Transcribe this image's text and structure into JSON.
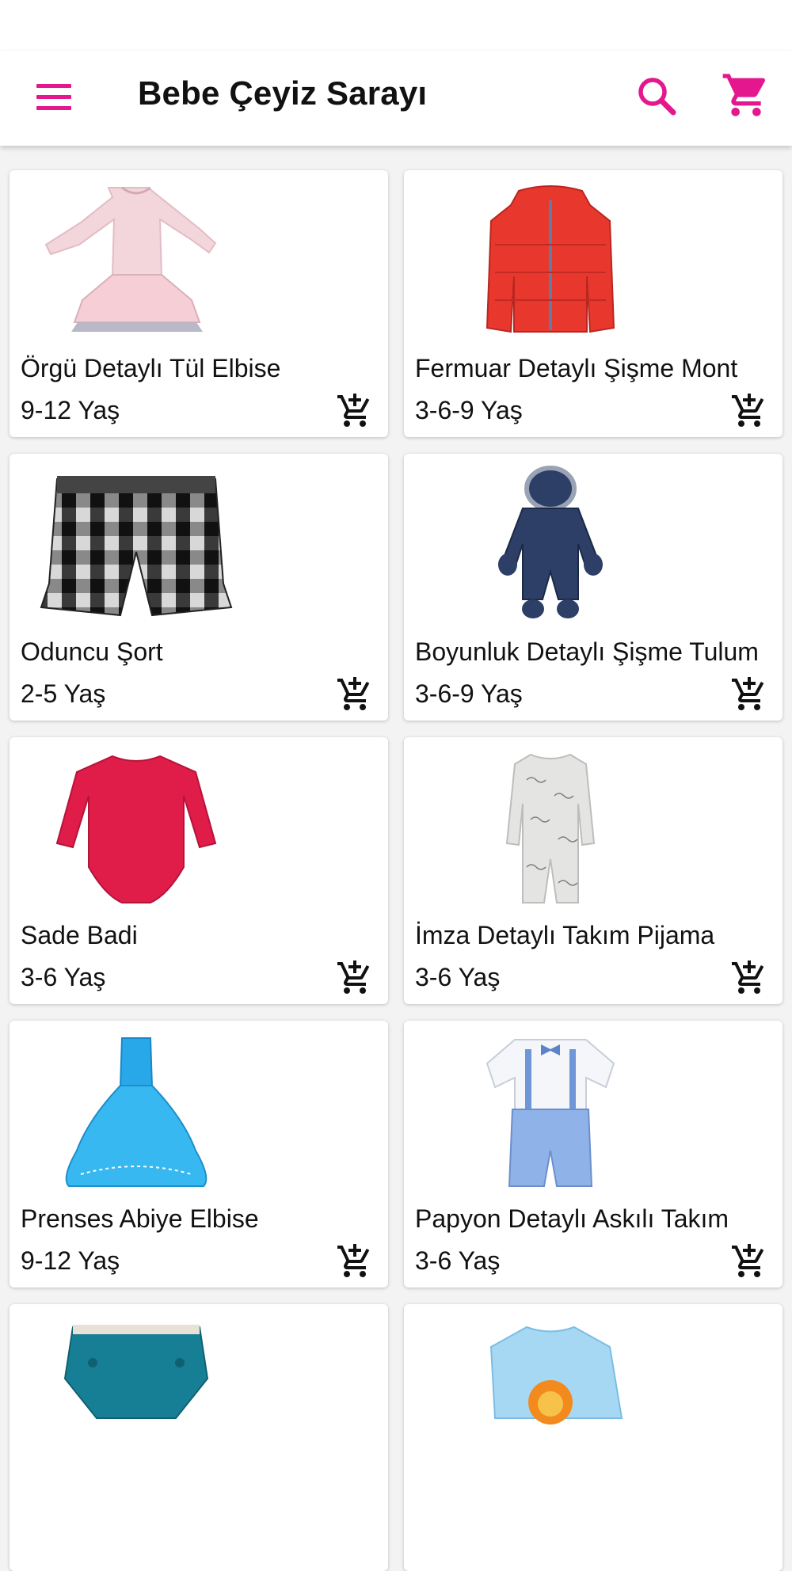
{
  "app_bar": {
    "title": "Bebe Çeyiz Sarayı",
    "accent_color": "#e5178f",
    "icons": [
      "menu-icon",
      "search-icon",
      "cart-icon"
    ]
  },
  "products": [
    {
      "name": "Örgü Detaylı Tül Elbise",
      "age": "9-12 Yaş"
    },
    {
      "name": "Fermuar Detaylı Şişme Mont",
      "age": "3-6-9 Yaş"
    },
    {
      "name": "Oduncu Şort",
      "age": "2-5 Yaş"
    },
    {
      "name": "Boyunluk Detaylı Şişme Tulum",
      "age": "3-6-9 Yaş"
    },
    {
      "name": "Sade Badi",
      "age": "3-6 Yaş"
    },
    {
      "name": "İmza Detaylı Takım Pijama",
      "age": "3-6 Yaş"
    },
    {
      "name": "Prenses Abiye Elbise",
      "age": "9-12 Yaş"
    },
    {
      "name": "Papyon Detaylı Askılı Takım",
      "age": "3-6 Yaş"
    },
    {
      "name": "",
      "age": ""
    },
    {
      "name": "",
      "age": ""
    }
  ],
  "add_to_cart_icon": "add-shopping-cart-icon"
}
